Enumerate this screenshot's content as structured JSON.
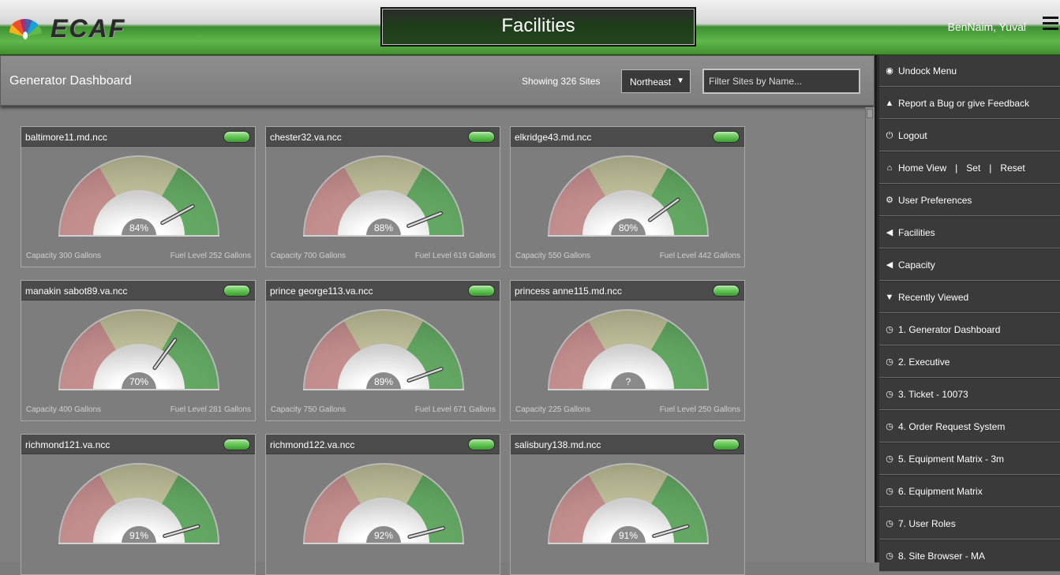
{
  "header": {
    "logo_text": "ECAF",
    "title": "Facilities",
    "user": "BenNaim, Yuval"
  },
  "toolbar": {
    "page_title": "Generator Dashboard",
    "site_count": "Showing 326 Sites",
    "region": "Northeast",
    "filter_placeholder": "Filter Sites by Name..."
  },
  "gauge_colors": {
    "red": "#c78d8d",
    "yellow": "#c4c49c",
    "green": "#5ea85e"
  },
  "sites": [
    {
      "name": "baltimore11.md.ncc",
      "level": "84%",
      "fill": 0.84,
      "capacity": "Capacity 300 Gallons",
      "fuel": "Fuel Level 252 Gallons"
    },
    {
      "name": "chester32.va.ncc",
      "level": "88%",
      "fill": 0.88,
      "capacity": "Capacity 700 Gallons",
      "fuel": "Fuel Level 619 Gallons"
    },
    {
      "name": "elkridge43.md.ncc",
      "level": "80%",
      "fill": 0.8,
      "capacity": "Capacity 550 Gallons",
      "fuel": "Fuel Level 442 Gallons"
    },
    {
      "name": "manakin sabot89.va.ncc",
      "level": "70%",
      "fill": 0.7,
      "capacity": "Capacity 400 Gallons",
      "fuel": "Fuel Level 281 Gallons"
    },
    {
      "name": "prince george113.va.ncc",
      "level": "89%",
      "fill": 0.89,
      "capacity": "Capacity 750 Gallons",
      "fuel": "Fuel Level 671 Gallons"
    },
    {
      "name": "princess anne115.md.ncc",
      "level": "?",
      "fill": null,
      "capacity": "Capacity 225 Gallons",
      "fuel": "Fuel Level 250 Gallons"
    },
    {
      "name": "richmond121.va.ncc",
      "level": "91%",
      "fill": 0.91,
      "capacity": "",
      "fuel": ""
    },
    {
      "name": "richmond122.va.ncc",
      "level": "92%",
      "fill": 0.92,
      "capacity": "",
      "fuel": ""
    },
    {
      "name": "salisbury138.md.ncc",
      "level": "91%",
      "fill": 0.91,
      "capacity": "",
      "fuel": ""
    }
  ],
  "menu": {
    "undock": "Undock Menu",
    "report_bug": "Report a Bug or give Feedback",
    "logout": "Logout",
    "home_view": "Home View",
    "sep": "|",
    "set": "Set",
    "reset": "Reset",
    "user_prefs": "User Preferences",
    "facilities": "Facilities",
    "capacity": "Capacity",
    "recently_viewed": "Recently Viewed",
    "recent": [
      "1. Generator Dashboard",
      "2. Executive",
      "3. Ticket - 10073",
      "4. Order Request System",
      "5. Equipment Matrix - 3m",
      "6. Equipment Matrix",
      "7. User Roles",
      "8. Site Browser - MA"
    ]
  }
}
